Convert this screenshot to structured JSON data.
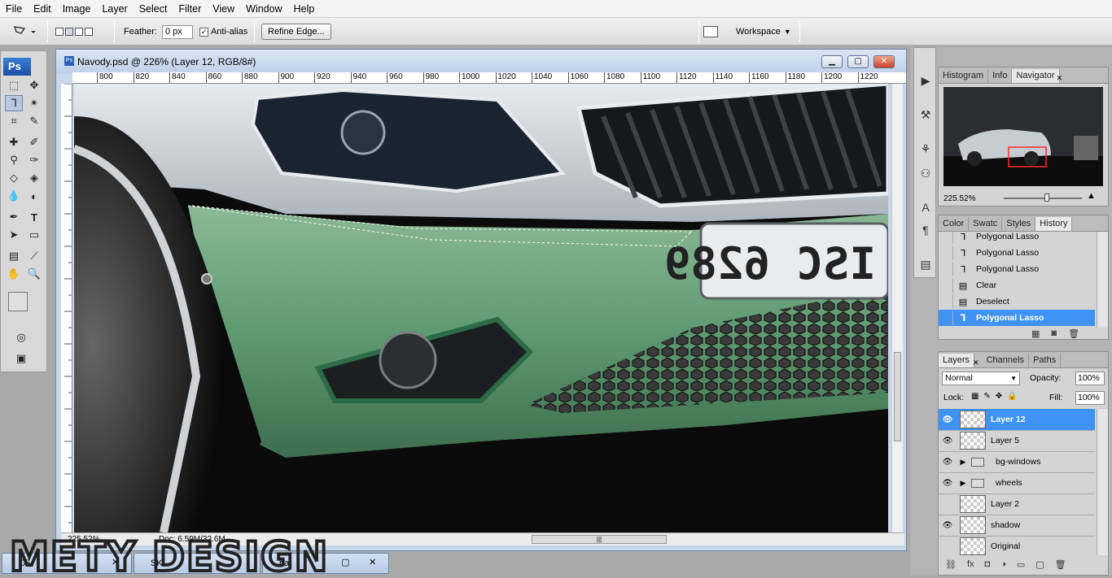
{
  "menu": [
    "File",
    "Edit",
    "Image",
    "Layer",
    "Select",
    "Filter",
    "View",
    "Window",
    "Help"
  ],
  "options": {
    "feather_label": "Feather:",
    "feather_value": "0 px",
    "antialias_label": "Anti-alias",
    "refine_edge": "Refine Edge...",
    "workspace": "Workspace"
  },
  "toolbox": {
    "logo": "Ps"
  },
  "document": {
    "title": "Navody.psd @ 226% (Layer 12, RGB/8#)",
    "ruler_ticks": [
      "800",
      "820",
      "840",
      "860",
      "880",
      "900",
      "920",
      "940",
      "960",
      "980",
      "1000",
      "1020",
      "1040",
      "1060",
      "1080",
      "1100",
      "1120",
      "1140",
      "1160",
      "1180",
      "1200",
      "1220"
    ],
    "zoom": "225.52%",
    "doc_info": "Doc: 6.59M/32.6M",
    "plate_text": "ISC 6289"
  },
  "navigator": {
    "tabs": [
      "Histogram",
      "Info",
      "Navigator"
    ],
    "zoom": "225.52%"
  },
  "history": {
    "tabs": [
      "Color",
      "Swatc",
      "Styles",
      "History"
    ],
    "items": [
      {
        "label": "Polygonal Lasso",
        "icon": "lasso-icon"
      },
      {
        "label": "Polygonal Lasso",
        "icon": "lasso-icon"
      },
      {
        "label": "Polygonal Lasso",
        "icon": "lasso-icon"
      },
      {
        "label": "Clear",
        "icon": "document-icon"
      },
      {
        "label": "Deselect",
        "icon": "document-icon"
      },
      {
        "label": "Polygonal Lasso",
        "icon": "lasso-icon",
        "selected": true
      }
    ]
  },
  "layers": {
    "tabs": [
      "Layers",
      "Channels",
      "Paths"
    ],
    "blend_mode": "Normal",
    "opacity_label": "Opacity:",
    "opacity": "100%",
    "lock_label": "Lock:",
    "fill_label": "Fill:",
    "fill": "100%",
    "items": [
      {
        "name": "Layer 12",
        "visible": true,
        "selected": true,
        "type": "layer"
      },
      {
        "name": "Layer 5",
        "visible": true,
        "type": "layer"
      },
      {
        "name": "bg-windows",
        "visible": true,
        "type": "group"
      },
      {
        "name": "wheels",
        "visible": true,
        "type": "group"
      },
      {
        "name": "Layer 2",
        "visible": false,
        "type": "layer"
      },
      {
        "name": "shadow",
        "visible": true,
        "type": "layer"
      },
      {
        "name": "Original",
        "visible": false,
        "type": "layer"
      }
    ]
  },
  "taskbar": {
    "windows": [
      "05-",
      "SK",
      "na"
    ]
  },
  "watermark": "METY DESIGN",
  "colors": {
    "accent": "#3f93f7",
    "bumper_green": "#5f9a72",
    "titlebar": "#c5d5ea"
  }
}
